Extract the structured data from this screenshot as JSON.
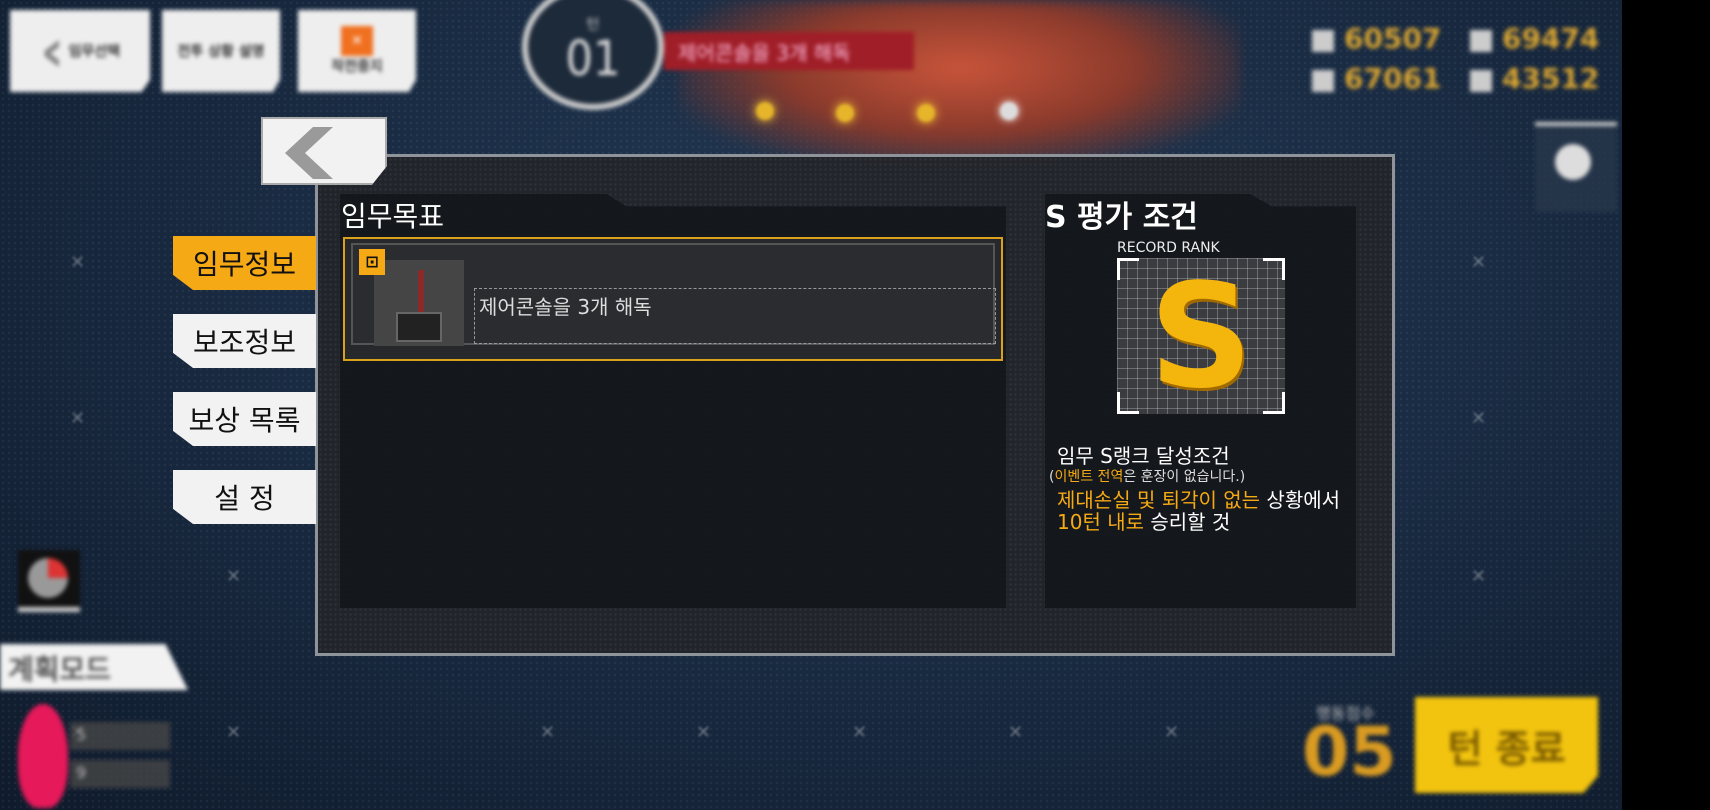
{
  "hud": {
    "top_buttons": [
      "임무선택",
      "전투 상황 설명",
      "작전중지"
    ],
    "stage": {
      "label": "턴",
      "number": "01"
    },
    "stage_banner": "제어콘솔을 3개 해독",
    "resources": [
      "60507",
      "69474",
      "67061",
      "43512"
    ],
    "plan_mode": "계획모드",
    "bottom_stats": [
      "5",
      "9"
    ],
    "action_points_label": "행동점수",
    "action_points_value": "05",
    "end_turn_label": "턴 종료"
  },
  "modal": {
    "side_tabs": [
      "임무정보",
      "보조정보",
      "보상 목록",
      "설 정"
    ],
    "active_tab_index": 0,
    "objectives": {
      "title": "임무목표",
      "items": [
        {
          "badge_icon": "objective-badge-icon",
          "text": "제어콘솔을 3개 해독"
        }
      ]
    },
    "s_rank": {
      "title": "S 평가 조건",
      "record_label": "RECORD RANK",
      "rank_letter": "S",
      "cond_title": "임무 S랭크 달성조건",
      "note_open": "(",
      "note_highlight": "이벤트 전역",
      "note_rest": "은 훈장이 없습니다.)",
      "line1_highlight": "제대손실 및 퇴각이 없는",
      "line1_rest": " 상황에서",
      "line2_highlight": "10턴 내로",
      "line2_rest": " 승리할 것"
    }
  },
  "colors": {
    "accent": "#f5a914",
    "modal_bg": "#22252a",
    "end_turn": "#f2c40f"
  }
}
